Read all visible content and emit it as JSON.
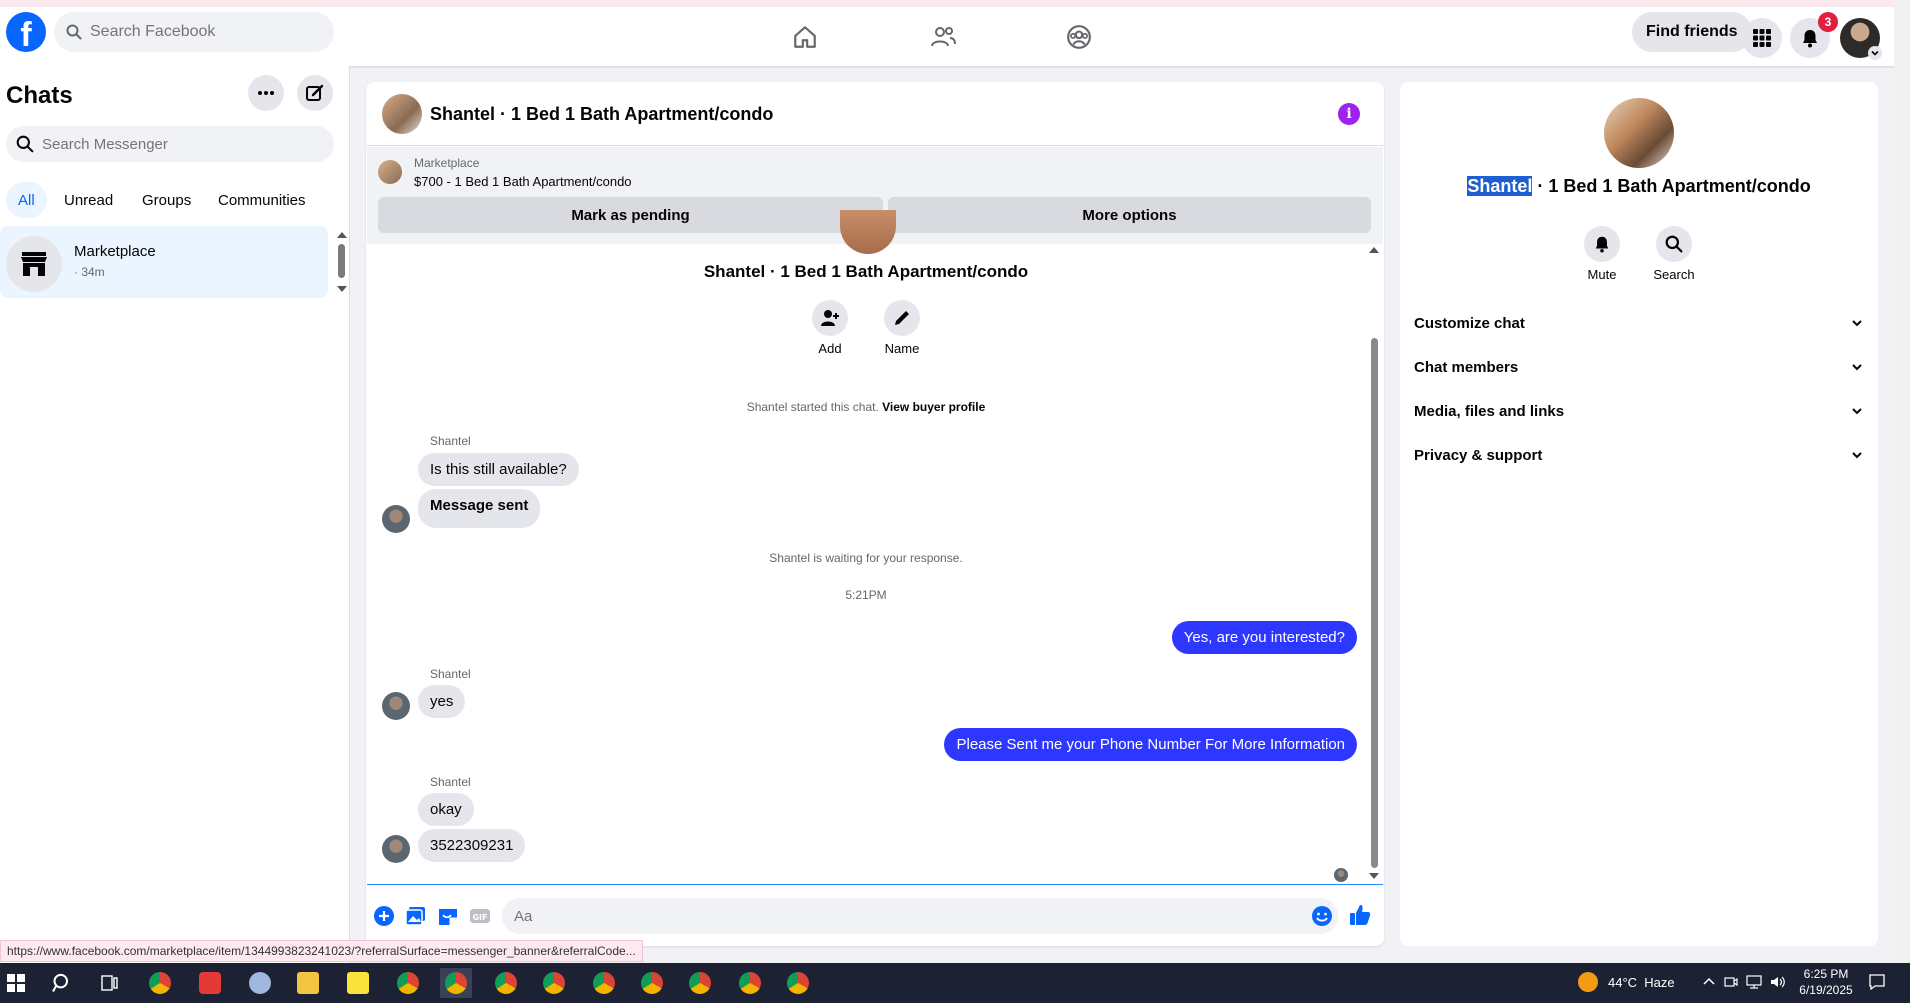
{
  "topnav": {
    "search_placeholder": "Search Facebook",
    "find_friends": "Find friends",
    "notification_count": "3"
  },
  "left": {
    "title": "Chats",
    "search_placeholder": "Search Messenger",
    "filters": [
      "All",
      "Unread",
      "Groups",
      "Communities"
    ],
    "chat": {
      "name": "Marketplace",
      "time": "· 34m"
    }
  },
  "center": {
    "header_title": "Shantel · 1 Bed 1 Bath Apartment/condo",
    "banner": {
      "label": "Marketplace",
      "price_title": "$700 - 1 Bed 1 Bath Apartment/condo",
      "mark_pending": "Mark as pending",
      "more_options": "More options"
    },
    "conv_title": "Shantel · 1 Bed 1 Bath Apartment/condo",
    "actions": {
      "add": "Add",
      "name": "Name"
    },
    "started_text": "Shantel started this chat.",
    "view_buyer_profile": "View buyer profile",
    "waiting_text": "Shantel is waiting for your response.",
    "timestamp": "5:21PM",
    "messages": {
      "sender": "Shantel",
      "in1": "Is this still available?",
      "in2": "Message sent",
      "out1": "Yes, are you interested?",
      "in3": "yes",
      "out2": "Please Sent me your Phone Number For More Information",
      "in4": "okay",
      "in5": "3522309231"
    },
    "composer_placeholder": "Aa"
  },
  "right": {
    "title_selected": "Shantel",
    "title_rest": " · 1 Bed 1 Bath Apartment/condo",
    "mute": "Mute",
    "search": "Search",
    "sections": [
      "Customize chat",
      "Chat members",
      "Media, files and links",
      "Privacy & support"
    ]
  },
  "status_url": "https://www.facebook.com/marketplace/item/1344993823241023/?referralSurface=messenger_banner&referralCode...",
  "taskbar": {
    "temperature": "44°C",
    "weather": "Haze",
    "time": "6:25 PM",
    "date": "6/19/2025"
  },
  "colors": {
    "fb_blue": "#0866ff",
    "outgoing_bubble": "#2e37ff",
    "info_purple": "#a020f0",
    "badge_red": "#e41e3f"
  }
}
